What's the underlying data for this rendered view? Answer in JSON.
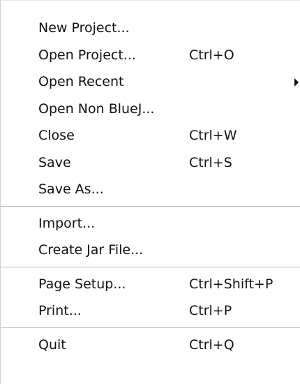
{
  "menu": {
    "items": [
      {
        "label": "New Project...",
        "shortcut": ""
      },
      {
        "label": "Open Project...",
        "shortcut": "Ctrl+O"
      },
      {
        "label": "Open Recent",
        "shortcut": "",
        "submenu": true
      },
      {
        "label": "Open Non BlueJ...",
        "shortcut": ""
      },
      {
        "label": "Close",
        "shortcut": "Ctrl+W"
      },
      {
        "label": "Save",
        "shortcut": "Ctrl+S"
      },
      {
        "label": "Save As...",
        "shortcut": ""
      },
      {
        "label": "Import...",
        "shortcut": ""
      },
      {
        "label": "Create Jar File...",
        "shortcut": ""
      },
      {
        "label": "Page Setup...",
        "shortcut": "Ctrl+Shift+P"
      },
      {
        "label": "Print...",
        "shortcut": "Ctrl+P"
      },
      {
        "label": "Quit",
        "shortcut": "Ctrl+Q"
      }
    ]
  }
}
